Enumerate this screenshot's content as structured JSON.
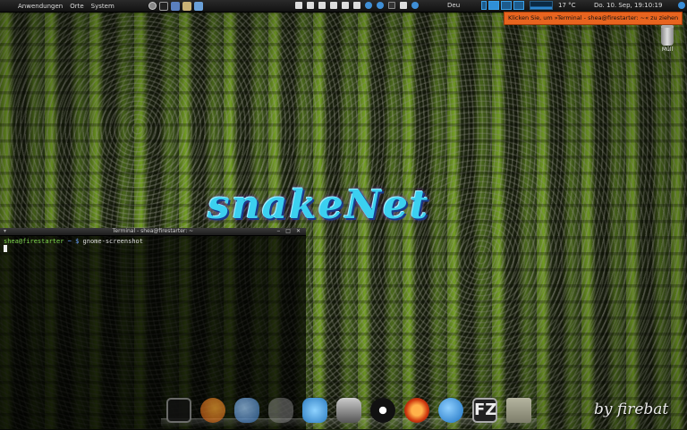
{
  "panel": {
    "menus": [
      "Anwendungen",
      "Orte",
      "System"
    ],
    "keyboard_layout": "Deu",
    "weather": "17 °C",
    "clock": "Do. 10. Sep, 19:10:19"
  },
  "tooltip": "Klicken Sie, um »Terminal - shea@firestarter: ~« zu ziehen",
  "desktop": {
    "trash_label": "Müll",
    "logo_text": "snakeNet",
    "signature": "by firebat"
  },
  "terminal": {
    "title": "Terminal - shea@firestarter: ~",
    "prompt_user": "shea@firestarter",
    "prompt_path": "~ $",
    "command": "gnome-screenshot"
  },
  "dock": {
    "icons": [
      "terminal-icon",
      "firefox-icon",
      "thunderbird-icon",
      "gimp-icon",
      "bird-icon",
      "camera-icon",
      "compiz-icon",
      "media-icon",
      "chat-icon",
      "filezilla-icon",
      "folder-icon"
    ],
    "filezilla_glyph": "FZ"
  }
}
